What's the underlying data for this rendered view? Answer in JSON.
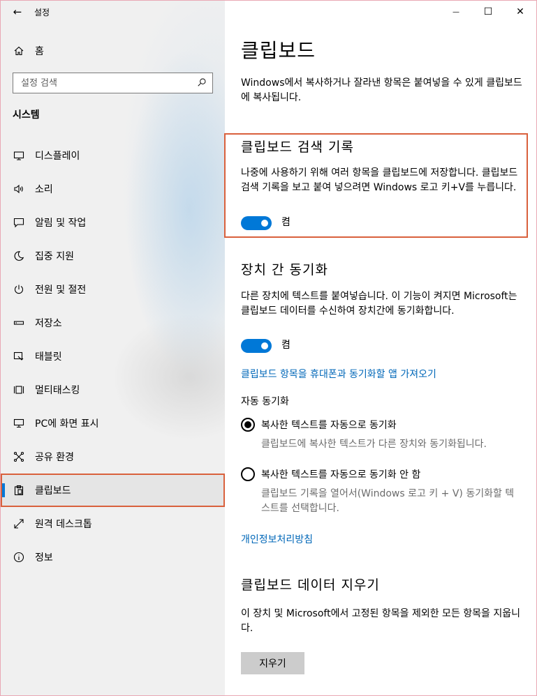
{
  "window": {
    "title": "설정",
    "back_glyph": "←",
    "minimize_glyph": "—",
    "maximize_glyph": "☐",
    "close_glyph": "✕"
  },
  "sidebar": {
    "home_label": "홈",
    "search_placeholder": "설정 검색",
    "section_title": "시스템",
    "items": [
      {
        "label": "디스플레이",
        "icon": "display-icon"
      },
      {
        "label": "소리",
        "icon": "sound-icon"
      },
      {
        "label": "알림 및 작업",
        "icon": "notification-icon"
      },
      {
        "label": "집중 지원",
        "icon": "moon-icon"
      },
      {
        "label": "전원 및 절전",
        "icon": "power-icon"
      },
      {
        "label": "저장소",
        "icon": "storage-icon"
      },
      {
        "label": "태블릿",
        "icon": "tablet-icon"
      },
      {
        "label": "멀티태스킹",
        "icon": "multitasking-icon"
      },
      {
        "label": "PC에 화면 표시",
        "icon": "project-icon"
      },
      {
        "label": "공유 환경",
        "icon": "shared-experience-icon"
      },
      {
        "label": "클립보드",
        "icon": "clipboard-icon",
        "selected": true
      },
      {
        "label": "원격 데스크톱",
        "icon": "remote-desktop-icon"
      },
      {
        "label": "정보",
        "icon": "info-icon"
      }
    ]
  },
  "main": {
    "title": "클립보드",
    "intro": "Windows에서 복사하거나 잘라낸 항목은 붙여넣을 수 있게 클립보드에 복사됩니다.",
    "history": {
      "heading": "클립보드 검색 기록",
      "description": "나중에 사용하기 위해 여러 항목을 클립보드에 저장합니다. 클립보드 검색 기록을 보고 붙여 넣으려면 Windows 로고 키+V를 누릅니다.",
      "toggle_label": "켬",
      "toggle_on": true
    },
    "sync": {
      "heading": "장치 간 동기화",
      "description": "다른 장치에 텍스트를 붙여넣습니다. 이 기능이 켜지면 Microsoft는 클립보드 데이터를 수신하여 장치간에 동기화합니다.",
      "toggle_label": "켬",
      "toggle_on": true,
      "link": "클립보드 항목을 휴대폰과 동기화할 앱 가져오기",
      "auto_sync_label": "자동 동기화",
      "option1": "복사한 텍스트를 자동으로 동기화",
      "option1_desc": "클립보드에 복사한 텍스트가 다른 장치와 동기화됩니다.",
      "option2": "복사한 텍스트를 자동으로 동기화 안 함",
      "option2_desc": "클립보드 기록을 열어서(Windows 로고 키 + V) 동기화할 텍스트를 선택합니다.",
      "privacy_link": "개인정보처리방침"
    },
    "clear": {
      "heading": "클립보드 데이터 지우기",
      "description": "이 장치 및 Microsoft에서 고정된 항목을 제외한 모든 항목을 지웁니다.",
      "button": "지우기"
    }
  }
}
